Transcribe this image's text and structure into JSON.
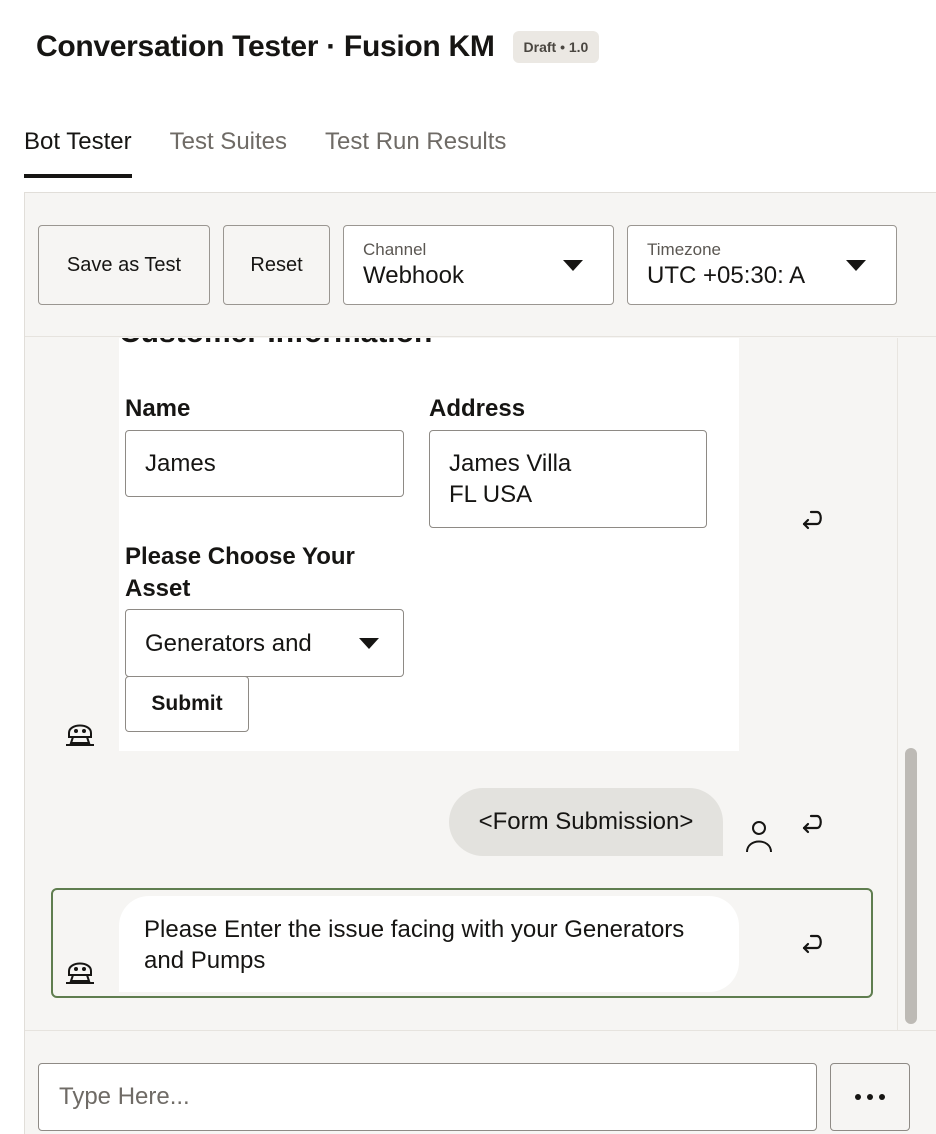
{
  "header": {
    "title": "Conversation Tester · Fusion KM",
    "badge": "Draft • 1.0"
  },
  "tabs": [
    {
      "label": "Bot Tester",
      "active": true
    },
    {
      "label": "Test Suites",
      "active": false
    },
    {
      "label": "Test Run Results",
      "active": false
    }
  ],
  "toolbar": {
    "save_label": "Save as Test",
    "reset_label": "Reset",
    "channel": {
      "label": "Channel",
      "value": "Webhook"
    },
    "timezone": {
      "label": "Timezone",
      "value": "UTC +05:30: A"
    }
  },
  "form": {
    "heading": "Customer Information",
    "name_label": "Name",
    "name_value": "James",
    "address_label": "Address",
    "address_line1": "James Villa",
    "address_line2": "FL USA",
    "asset_label_line1": "Please Choose Your",
    "asset_label_line2": "Asset",
    "asset_value": "Generators and",
    "submit_label": "Submit"
  },
  "messages": {
    "user_text": "<Form Submission>",
    "bot_text": "Please Enter the issue facing with your Generators and Pumps"
  },
  "composer": {
    "placeholder": "Type Here..."
  },
  "icons": {
    "bot": "bot-avatar-icon",
    "user": "user-avatar-icon",
    "reset": "return-arrow-icon",
    "more": "ellipsis-icon"
  }
}
